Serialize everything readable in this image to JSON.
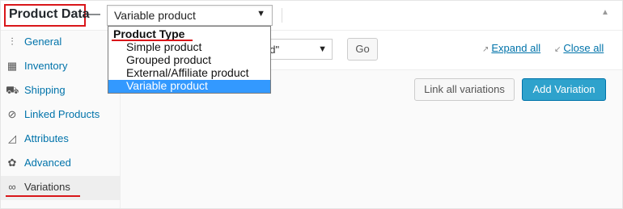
{
  "header": {
    "title": "Product Data",
    "separator": "—",
    "product_type_selected": "Variable product",
    "collapse_glyph": "▲"
  },
  "dropdown": {
    "group_label": "Product Type",
    "options": [
      "Simple product",
      "Grouped product",
      "External/Affiliate product",
      "Variable product"
    ],
    "selected_index": 3
  },
  "sidebar": {
    "items": [
      {
        "label": "General",
        "icon": "general-icon",
        "glyph": "⫶"
      },
      {
        "label": "Inventory",
        "icon": "inventory-icon",
        "glyph": "▦"
      },
      {
        "label": "Shipping",
        "icon": "truck-icon",
        "glyph": "⛟"
      },
      {
        "label": "Linked Products",
        "icon": "link-icon",
        "glyph": "⊘"
      },
      {
        "label": "Attributes",
        "icon": "attributes-icon",
        "glyph": "◿"
      },
      {
        "label": "Advanced",
        "icon": "gear-icon",
        "glyph": "✿"
      },
      {
        "label": "Variations",
        "icon": "variations-icon",
        "glyph": "∞"
      }
    ],
    "active_index": 6
  },
  "toolbar": {
    "bulk_select_value": "ed\"",
    "go_label": "Go",
    "expand_all": "Expand all",
    "close_all": "Close all",
    "expand_glyph": "↗",
    "close_glyph": "↙"
  },
  "actions": {
    "link_all": "Link all variations",
    "add_variation": "Add Variation"
  },
  "colors": {
    "accent": "#2ea2cc",
    "link": "#0073aa",
    "highlight": "#3399ff",
    "annotation_red": "#d9161a"
  }
}
